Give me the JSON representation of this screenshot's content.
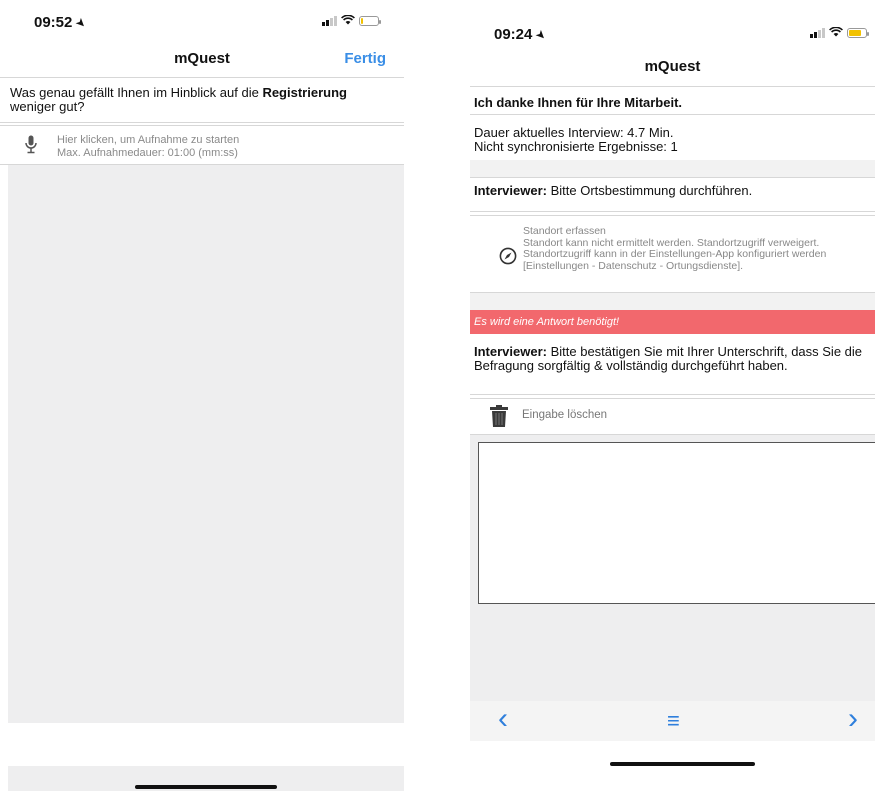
{
  "left": {
    "status": {
      "time": "09:52"
    },
    "nav": {
      "title": "mQuest",
      "done": "Fertig"
    },
    "question": {
      "prefix": "Was genau gefällt Ihnen im Hinblick auf die ",
      "bold": "Registrierung",
      "suffix": " weniger gut?"
    },
    "recorder": {
      "line1": "Hier klicken, um Aufnahme zu starten",
      "line2": "Max. Aufnahmedauer: 01:00 (mm:ss)",
      "icon": "microphone-icon"
    }
  },
  "right": {
    "status": {
      "time": "09:24"
    },
    "nav": {
      "title": "mQuest"
    },
    "thanks": "Ich danke Ihnen für Ihre Mitarbeit.",
    "duration": "Dauer aktuelles Interview: 4.7 Min.",
    "unsynced": "Nicht synchronisierte Ergebnisse: 1",
    "location_prompt": {
      "bold": "Interviewer:",
      "text": " Bitte Ortsbestimmung durchführen."
    },
    "location": {
      "title": "Standort erfassen",
      "message": "Standort kann nicht ermittelt werden. Standortzugriff verweigert. Standortzugriff kann in der Einstellungen-App konfiguriert werden [Einstellungen - Datenschutz - Ortungsdienste].",
      "icon": "compass-icon"
    },
    "error": "Es wird eine Antwort benötigt!",
    "signature_prompt": {
      "bold": "Interviewer:",
      "text": " Bitte bestätigen Sie mit Ihrer Unterschrift, dass Sie die Befragung sorgfältig & vollständig durchgeführt haben."
    },
    "clear": {
      "label": "Eingabe löschen",
      "icon": "trash-icon"
    },
    "toolbar": {
      "prev": "‹",
      "menu": "≡",
      "next": "›"
    },
    "accent": "#2f7fdc",
    "error_color": "#f2686d"
  }
}
